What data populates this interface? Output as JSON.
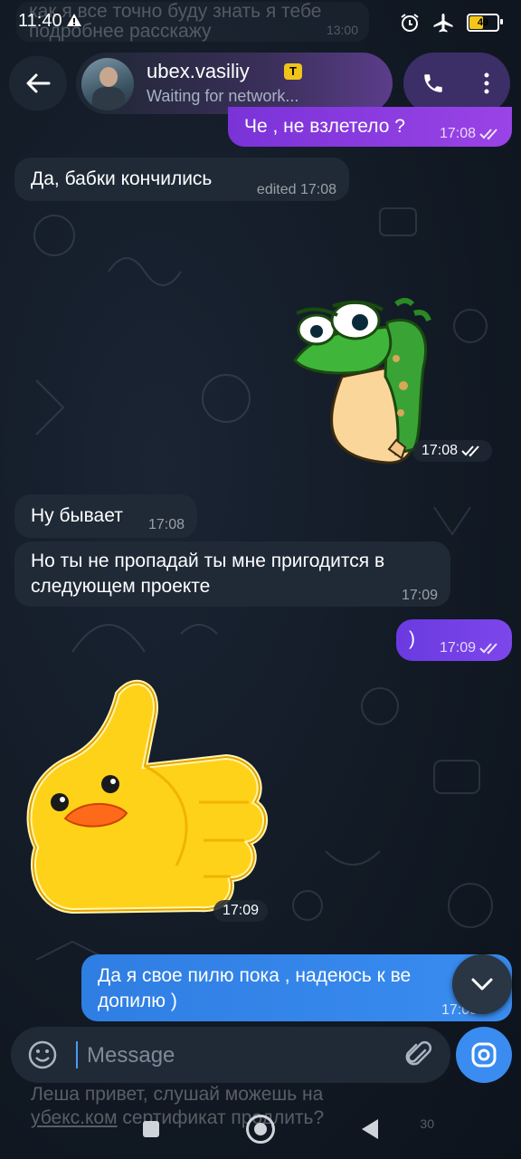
{
  "status_bar": {
    "time": "11:40",
    "battery": "49"
  },
  "faded_top": {
    "text": "как я все точно буду знать я тебе подробнее расскажу",
    "time": "13:00"
  },
  "header": {
    "name": "ubex.vasiliy",
    "badge": "T",
    "status": "Waiting for network..."
  },
  "messages": [
    {
      "id": "m1",
      "dir": "out",
      "text": "Че , не взлетело ?",
      "time": "17:08"
    },
    {
      "id": "m2",
      "dir": "in",
      "text": "Да, бабки кончились",
      "time": "edited 17:08"
    },
    {
      "id": "m3",
      "dir": "out",
      "sticker": "frog",
      "time": "17:08"
    },
    {
      "id": "m4",
      "dir": "in",
      "text": "Ну бывает",
      "time": "17:08"
    },
    {
      "id": "m5",
      "dir": "in",
      "text": "Но ты не пропадай ты мне пригодится в следующем проекте",
      "time": "17:09"
    },
    {
      "id": "m6",
      "dir": "out",
      "text": ")",
      "time": "17:09"
    },
    {
      "id": "m7",
      "dir": "in",
      "sticker": "duck-thumbs-up",
      "time": "17:09"
    },
    {
      "id": "m8",
      "dir": "out",
      "text": "Да я свое пилю пока , надеюсь к ве допилю )",
      "time": "17:09"
    }
  ],
  "composer": {
    "placeholder": "Message"
  },
  "faded_bottom": {
    "line1": "Леша привет, слушай можешь на",
    "link": "убекс.ком",
    "line2_rest": " сертификат продлить?",
    "time": "30"
  },
  "colors": {
    "accent_out": "#9a43e6",
    "accent_blue": "#3a8cf0",
    "bubble_in": "#1f2a36"
  }
}
